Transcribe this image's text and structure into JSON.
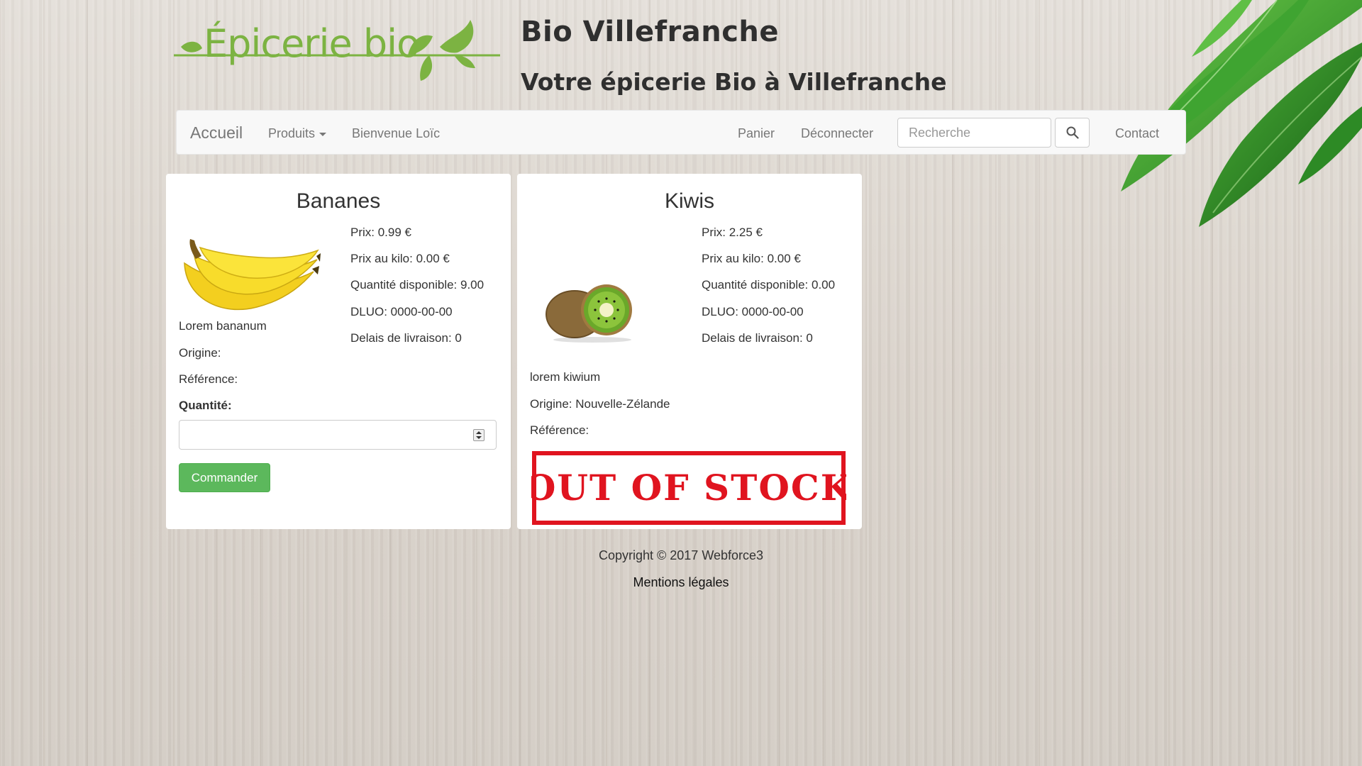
{
  "header": {
    "logo_text": "Épicerie bio",
    "title": "Bio Villefranche",
    "subtitle": "Votre épicerie Bio à Villefranche"
  },
  "navbar": {
    "brand": "Accueil",
    "products": "Produits",
    "welcome": "Bienvenue Loïc",
    "cart": "Panier",
    "logout": "Déconnecter",
    "search_placeholder": "Recherche",
    "contact": "Contact"
  },
  "products": [
    {
      "name": "Bananes",
      "price": "Prix: 0.99 €",
      "price_per_kilo": "Prix au kilo: 0.00 €",
      "quantity_available": "Quantité disponible: 9.00",
      "dluo": "DLUO: 0000-00-00",
      "delivery": "Delais de livraison: 0",
      "description": "Lorem bananum",
      "origin": "Origine:",
      "reference": "Référence:",
      "quantity_label": "Quantité:",
      "order_button": "Commander",
      "image_icon": "banana-image"
    },
    {
      "name": "Kiwis",
      "price": "Prix: 2.25 €",
      "price_per_kilo": "Prix au kilo: 0.00 €",
      "quantity_available": "Quantité disponible: 0.00",
      "dluo": "DLUO: 0000-00-00",
      "delivery": "Delais de livraison: 0",
      "description": "lorem kiwium",
      "origin": "Origine: Nouvelle-Zélande",
      "reference": "Référence:",
      "stamp": "OUT OF STOCK",
      "image_icon": "kiwi-image"
    }
  ],
  "footer": {
    "copyright": "Copyright © 2017 Webforce3",
    "legal": "Mentions légales"
  },
  "colors": {
    "brand_green": "#7cb342",
    "button_green": "#5cb85c",
    "stamp_red": "#e0141f"
  }
}
